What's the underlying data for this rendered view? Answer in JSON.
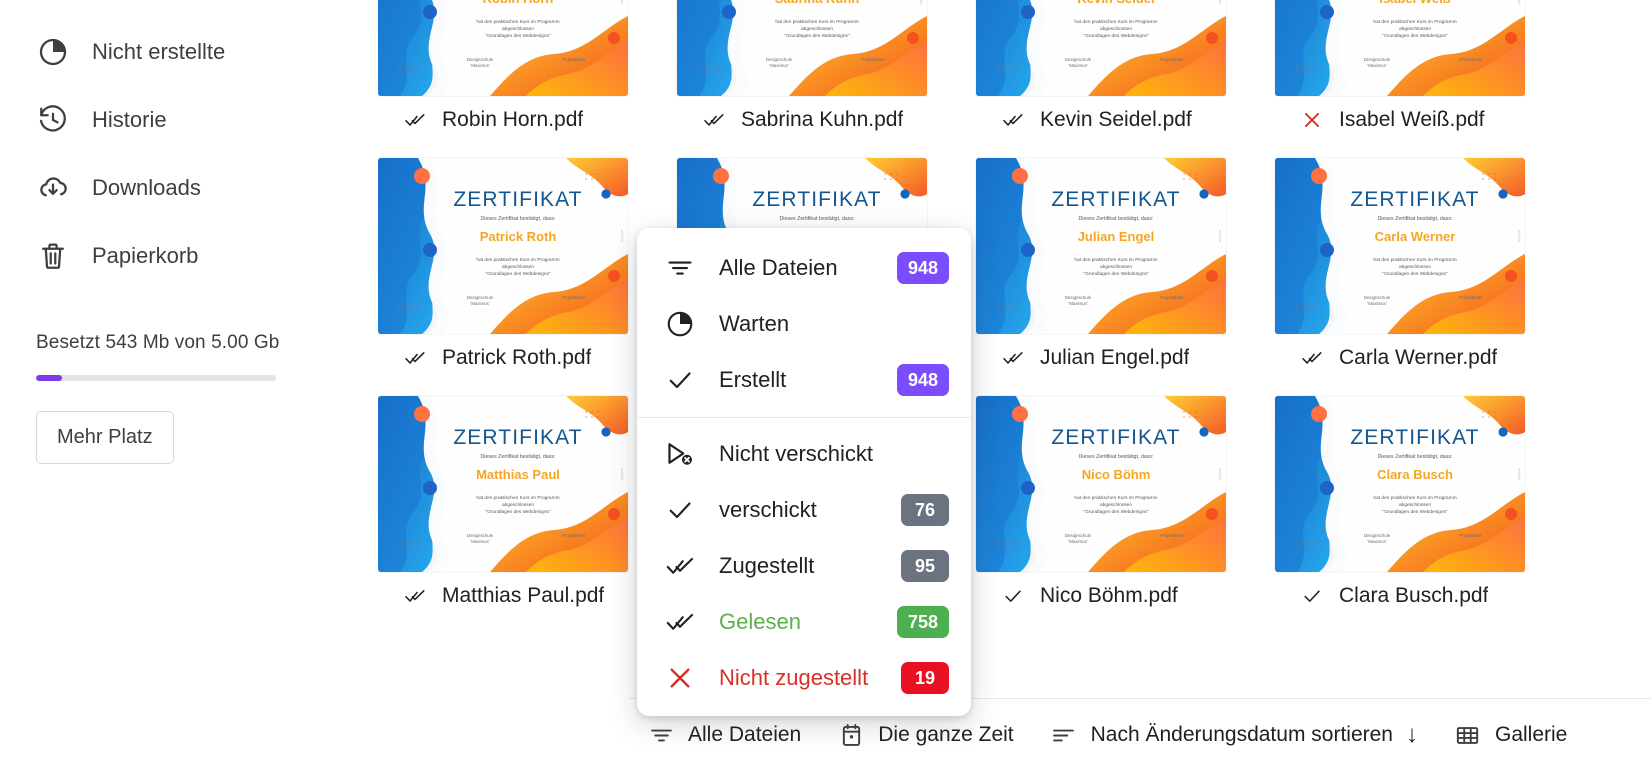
{
  "sidebar": {
    "items": [
      {
        "label": "Nicht erstellte",
        "icon": "pie-quarter-icon"
      },
      {
        "label": "Historie",
        "icon": "history-clock-icon"
      },
      {
        "label": "Downloads",
        "icon": "download-cloud-icon"
      },
      {
        "label": "Papierkorb",
        "icon": "trash-icon"
      }
    ],
    "storage": {
      "text": "Besetzt 543 Mb von 5.00 Gb",
      "used_percent": 11,
      "fill_color": "#7c3aed",
      "track_color": "#e4e4e6"
    },
    "more_space_label": "Mehr Platz"
  },
  "menu": {
    "groups": [
      {
        "items": [
          {
            "label": "Alle Dateien",
            "icon": "filter-lines-icon",
            "badge": "948",
            "badge_color": "#7c4dff",
            "label_color": "#202124"
          },
          {
            "label": "Warten",
            "icon": "pie-quarter-icon",
            "badge": null,
            "badge_color": null,
            "label_color": "#202124"
          },
          {
            "label": "Erstellt",
            "icon": "check-icon",
            "badge": "948",
            "badge_color": "#7c4dff",
            "label_color": "#202124"
          }
        ]
      },
      {
        "items": [
          {
            "label": "Nicht verschickt",
            "icon": "send-blocked-icon",
            "badge": null,
            "badge_color": null,
            "label_color": "#202124"
          },
          {
            "label": "verschickt",
            "icon": "check-icon",
            "badge": "76",
            "badge_color": "#6b7280",
            "label_color": "#202124"
          },
          {
            "label": "Zugestellt",
            "icon": "double-check-icon",
            "badge": "95",
            "badge_color": "#6b7280",
            "label_color": "#202124"
          },
          {
            "label": "Gelesen",
            "icon": "double-check-green-icon",
            "badge": "758",
            "badge_color": "#4caf50",
            "label_color": "#5fae4e"
          },
          {
            "label": "Nicht zugestellt",
            "icon": "close-x-red-icon",
            "badge": "19",
            "badge_color": "#e81123",
            "label_color": "#d93025"
          }
        ]
      }
    ]
  },
  "bottombar": {
    "items": [
      {
        "label": "Alle Dateien",
        "icon": "filter-lines-icon",
        "trailing": null
      },
      {
        "label": "Die ganze Zeit",
        "icon": "calendar-icon",
        "trailing": null
      },
      {
        "label": "Nach Änderungsdatum sortieren",
        "icon": "sort-lines-icon",
        "trailing": "↓"
      },
      {
        "label": "Gallerie",
        "icon": "grid-view-icon",
        "trailing": null
      }
    ]
  },
  "certificate": {
    "title": "ZERTIFIKAT",
    "subtitle": "Dieses Zertifikat bestätigt, dass:",
    "body_line1": "hat den praktischen Kurs im Programm",
    "body_line2": "abgeschlossen",
    "body_line3": "\"Grundlagen des Webdesigns\"",
    "footer_left_line1": "Designschule",
    "footer_left_line2": "'Maximus'",
    "footer_right": "Projektleiter",
    "title_color": "#14568f",
    "name_color": "#f5a623"
  },
  "files": [
    {
      "name": "Robin Horn",
      "filename": "Robin Horn.pdf",
      "status": "read",
      "status_icon": "double-check-green-icon"
    },
    {
      "name": "Sabrina Kuhn",
      "filename": "Sabrina Kuhn.pdf",
      "status": "read",
      "status_icon": "double-check-green-icon"
    },
    {
      "name": "Kevin Seidel",
      "filename": "Kevin Seidel.pdf",
      "status": "read",
      "status_icon": "double-check-green-icon"
    },
    {
      "name": "Isabel Weiß",
      "filename": "Isabel Weiß.pdf",
      "status": "failed",
      "status_icon": "close-x-red-icon"
    },
    {
      "name": "Patrick Roth",
      "filename": "Patrick Roth.pdf",
      "status": "read",
      "status_icon": "double-check-green-icon"
    },
    {
      "name": "",
      "filename": "",
      "status": "none",
      "status_icon": "none"
    },
    {
      "name": "Julian Engel",
      "filename": "Julian Engel.pdf",
      "status": "delivered",
      "status_icon": "double-check-icon"
    },
    {
      "name": "Carla Werner",
      "filename": "Carla Werner.pdf",
      "status": "delivered",
      "status_icon": "double-check-icon"
    },
    {
      "name": "Matthias Paul",
      "filename": "Matthias Paul.pdf",
      "status": "delivered",
      "status_icon": "double-check-icon"
    },
    {
      "name": "",
      "filename": "",
      "status": "none",
      "status_icon": "none"
    },
    {
      "name": "Nico Böhm",
      "filename": "Nico Böhm.pdf",
      "status": "sent",
      "status_icon": "check-icon"
    },
    {
      "name": "Clara Busch",
      "filename": "Clara Busch.pdf",
      "status": "sent",
      "status_icon": "check-icon"
    }
  ]
}
